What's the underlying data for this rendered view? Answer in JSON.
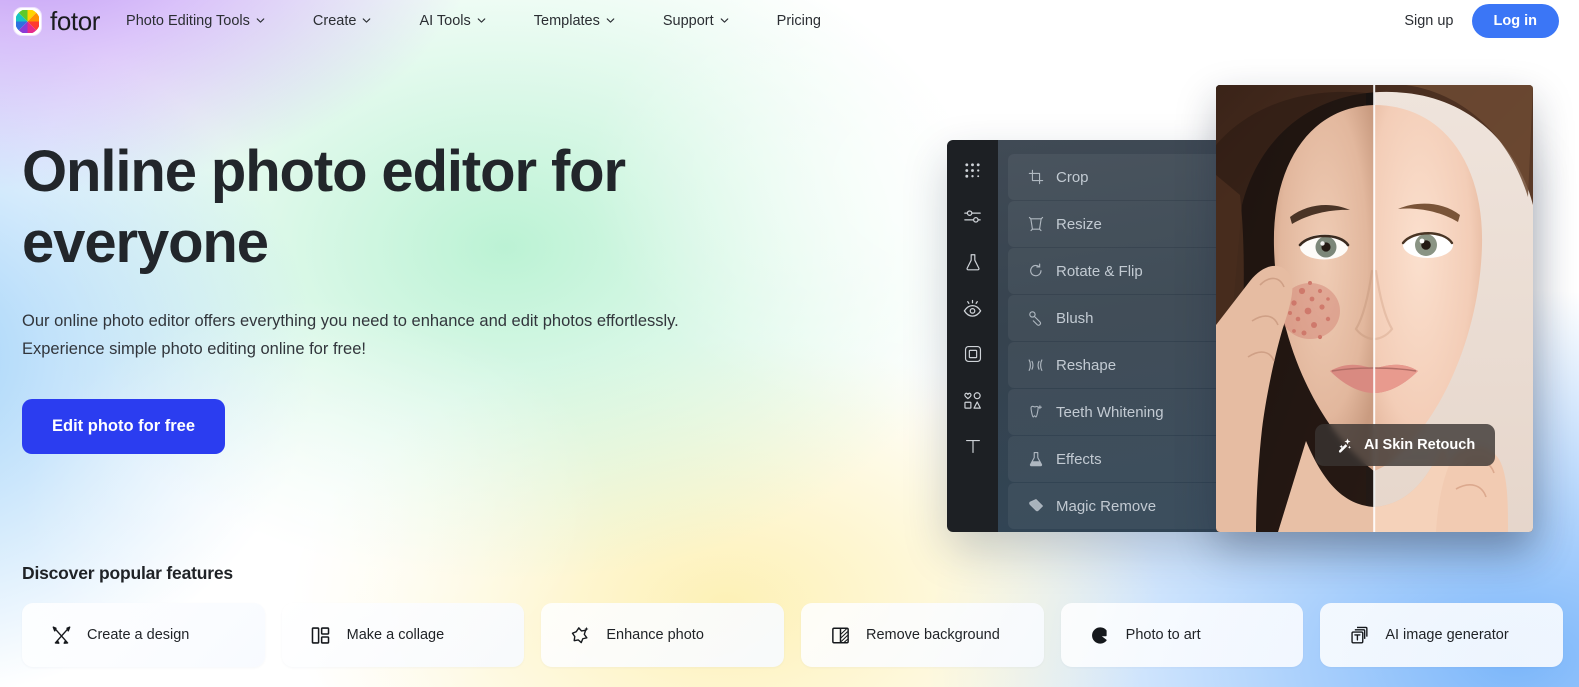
{
  "header": {
    "brand_name": "fotor",
    "brand_icon": "fotor-color-wheel-logo",
    "nav": [
      {
        "label": "Photo Editing Tools",
        "has_caret": true,
        "icon": "chevron-down-icon"
      },
      {
        "label": "Create",
        "has_caret": true,
        "icon": "chevron-down-icon"
      },
      {
        "label": "AI Tools",
        "has_caret": true,
        "icon": "chevron-down-icon"
      },
      {
        "label": "Templates",
        "has_caret": true,
        "icon": "chevron-down-icon"
      },
      {
        "label": "Support",
        "has_caret": true,
        "icon": "chevron-down-icon"
      },
      {
        "label": "Pricing",
        "has_caret": false,
        "icon": ""
      }
    ],
    "signup_label": "Sign up",
    "login_label": "Log in",
    "login_color": "#3b76f6"
  },
  "hero": {
    "title": "Online photo editor for everyone",
    "subtitle_line1": "Our online photo editor offers everything you need to enhance and edit photos effortlessly.",
    "subtitle_line2": "Experience simple photo editing online for free!",
    "cta_label": "Edit photo for free",
    "cta_color": "#2b3df0"
  },
  "editor": {
    "rail_icons": [
      "dot-grid-icon",
      "adjust-sliders-icon",
      "flask-effects-icon",
      "eye-retouch-icon",
      "frame-border-icon",
      "shapes-elements-icon",
      "text-tool-icon"
    ],
    "tools": [
      {
        "label": "Crop",
        "icon": "crop-icon"
      },
      {
        "label": "Resize",
        "icon": "resize-icon"
      },
      {
        "label": "Rotate & Flip",
        "icon": "rotate-flip-icon"
      },
      {
        "label": "Blush",
        "icon": "blush-icon"
      },
      {
        "label": "Reshape",
        "icon": "reshape-icon"
      },
      {
        "label": "Teeth Whitening",
        "icon": "teeth-whitening-icon"
      },
      {
        "label": "Effects",
        "icon": "effects-flask-icon"
      },
      {
        "label": "Magic Remove",
        "icon": "magic-remove-eraser-icon"
      }
    ],
    "badge_label": "AI Skin Retouch",
    "badge_icon": "ai-sparkle-wand-icon",
    "preview_alt": "before-after-skin-retouch-portrait"
  },
  "features": {
    "heading": "Discover popular features",
    "cards": [
      {
        "label": "Create a design",
        "icon": "pencil-ruler-icon"
      },
      {
        "label": "Make a collage",
        "icon": "collage-grid-icon"
      },
      {
        "label": "Enhance photo",
        "icon": "sparkle-star-icon"
      },
      {
        "label": "Remove background",
        "icon": "remove-background-icon"
      },
      {
        "label": "Photo to art",
        "icon": "photo-to-art-icon"
      },
      {
        "label": "AI image generator",
        "icon": "ai-image-generator-icon"
      }
    ]
  }
}
